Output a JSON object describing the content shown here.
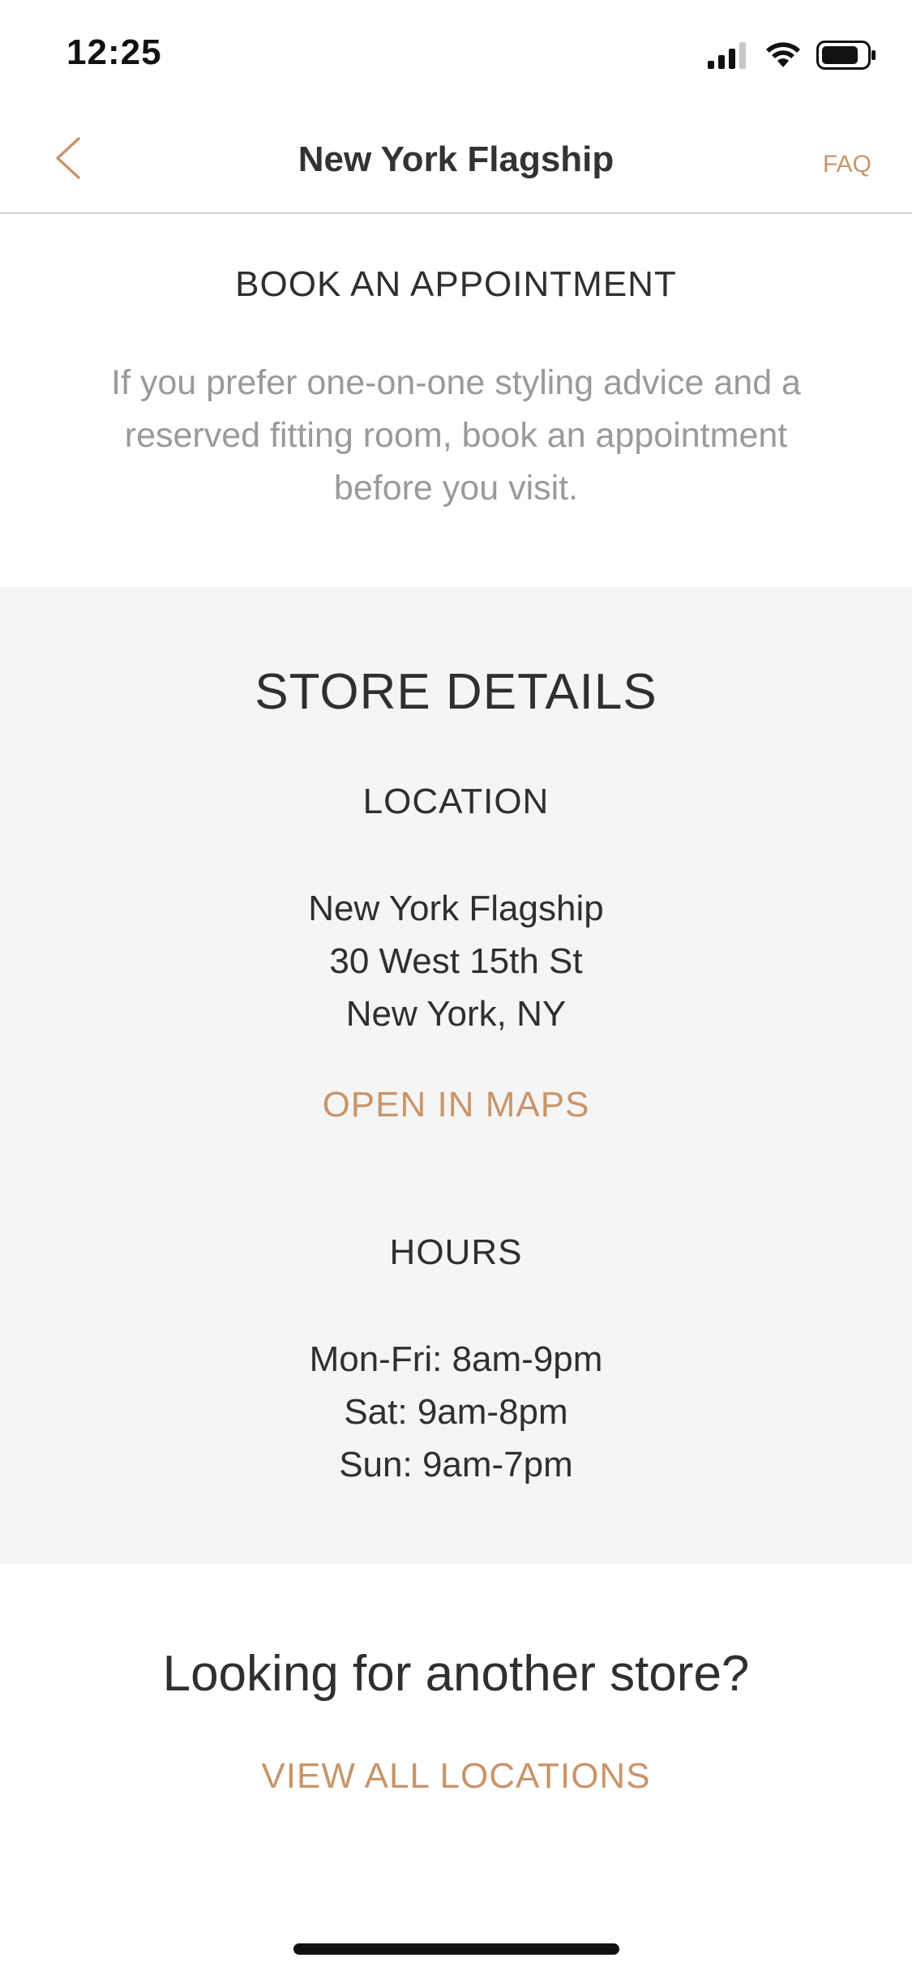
{
  "status_bar": {
    "time": "12:25",
    "icons": [
      "cellular-signal-icon",
      "wifi-icon",
      "battery-icon"
    ]
  },
  "nav": {
    "back_icon": "chevron-left-icon",
    "title": "New York Flagship",
    "faq_label": "FAQ"
  },
  "appointment": {
    "heading": "BOOK AN APPOINTMENT",
    "description": "If you prefer one-on-one styling advice and a reserved fitting room, book an appointment before you visit."
  },
  "store_details": {
    "heading": "STORE DETAILS",
    "location": {
      "heading": "LOCATION",
      "lines": [
        "New York Flagship",
        "30 West 15th St",
        "New York, NY"
      ],
      "maps_link": "OPEN IN MAPS"
    },
    "hours": {
      "heading": "HOURS",
      "lines": [
        "Mon-Fri: 8am-9pm",
        "Sat: 9am-8pm",
        "Sun: 9am-7pm"
      ]
    }
  },
  "other_store": {
    "heading": "Looking for another store?",
    "link": "VIEW ALL LOCATIONS"
  },
  "colors": {
    "accent": "#c8956a",
    "text": "#2f2f2f",
    "muted_text": "#9a9a9a",
    "section_bg": "#f5f5f5"
  }
}
